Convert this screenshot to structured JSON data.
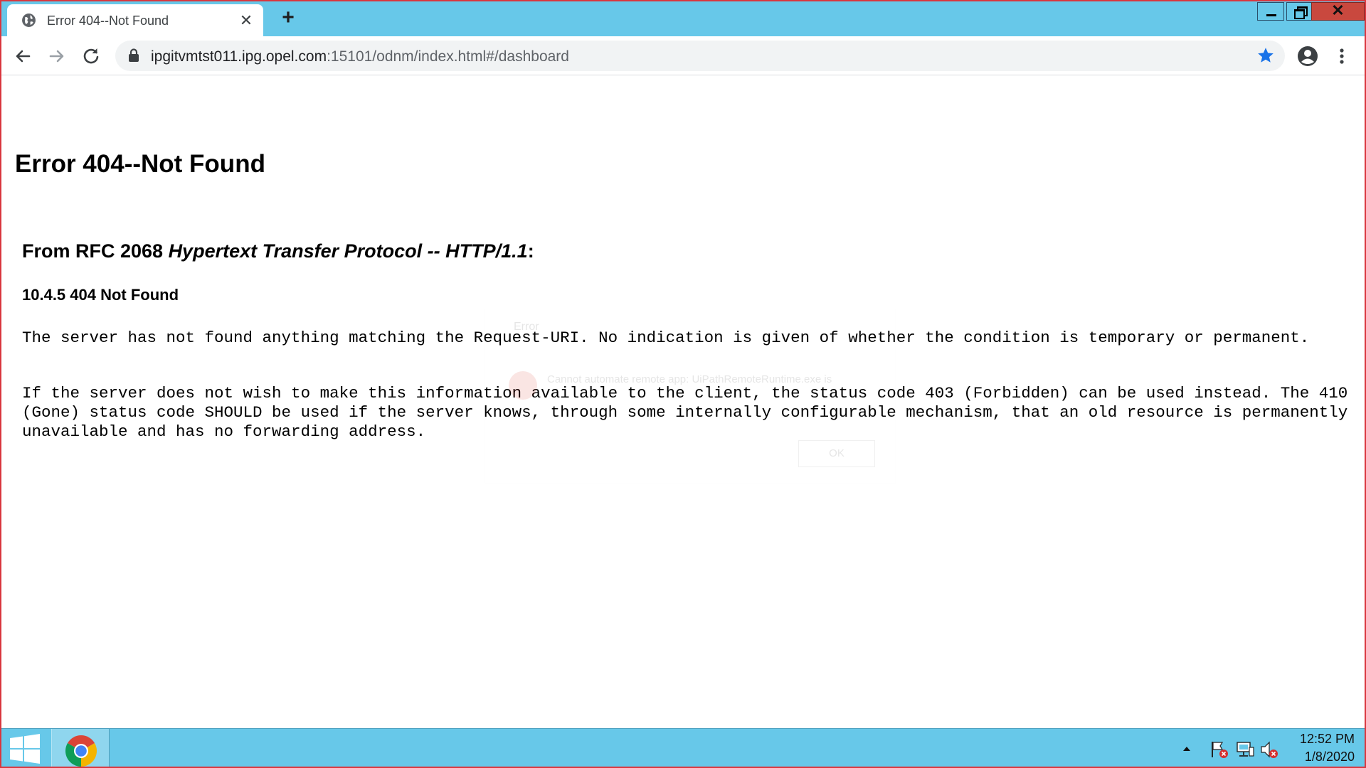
{
  "browser": {
    "tab_title": "Error 404--Not Found",
    "url_host": "ipgitvmtst011.ipg.opel.com",
    "url_path": ":15101/odnm/index.html#/dashboard"
  },
  "page": {
    "heading": "Error 404--Not Found",
    "subheading_prefix": "From RFC 2068 ",
    "subheading_italic": "Hypertext Transfer Protocol -- HTTP/1.1",
    "subheading_suffix": ":",
    "section_title": "10.4.5 404 Not Found",
    "paragraph1": "The server has not found anything matching the Request-URI. No indication is given of whether the condition is temporary or permanent.",
    "paragraph2": "If the server does not wish to make this information available to the client, the status code 403 (Forbidden) can be used instead. The 410 (Gone) status code SHOULD be used if the server knows, through some internally configurable mechanism, that an old resource is permanently unavailable and has no forwarding address."
  },
  "ghost_dialog": {
    "title": "Error",
    "message": "Cannot automate remote app: UiPathRemoteRuntime.exe is",
    "ok_label": "OK"
  },
  "taskbar": {
    "time": "12:52 PM",
    "date": "1/8/2020"
  },
  "colors": {
    "title_bar": "#67c8e9",
    "window_border": "#d9363e",
    "close_button": "#c9483e",
    "bookmark_star": "#1a73e8"
  },
  "icons": [
    "globe-icon",
    "close-icon",
    "plus-icon",
    "back-icon",
    "forward-icon",
    "reload-icon",
    "lock-icon",
    "star-icon",
    "profile-icon",
    "menu-icon",
    "windows-logo-icon",
    "chrome-icon",
    "tray-up-icon",
    "action-center-flag-icon",
    "network-icon",
    "volume-muted-icon"
  ]
}
